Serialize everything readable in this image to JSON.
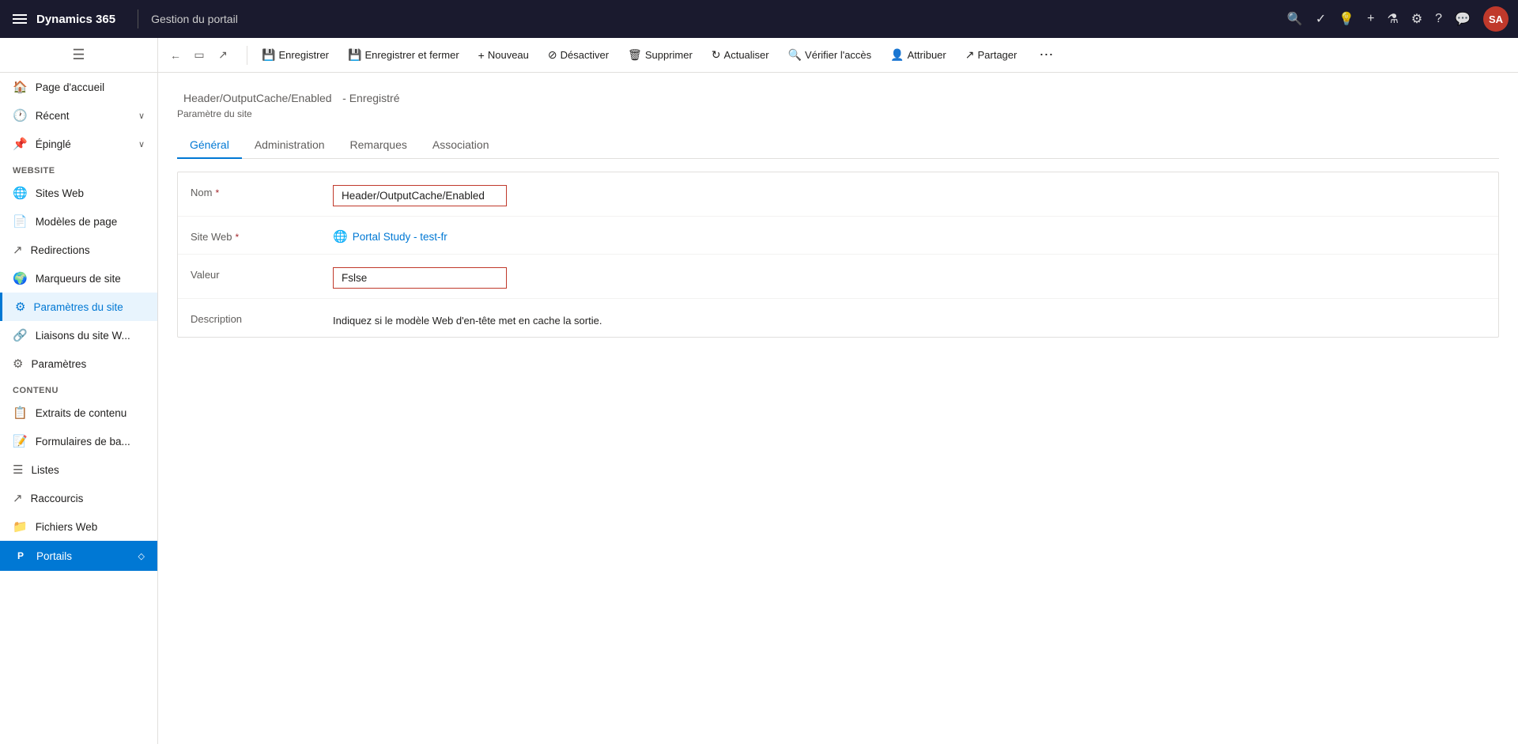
{
  "topbar": {
    "brand": "Dynamics 365",
    "portal": "Gestion du portail",
    "avatar": "SA",
    "icons": {
      "search": "🔍",
      "check": "✓",
      "bulb": "💡",
      "plus": "+",
      "filter": "⚗",
      "gear": "⚙",
      "help": "?",
      "chat": "💬"
    }
  },
  "cmdbar": {
    "back_icon": "←",
    "form_icon": "▭",
    "open_icon": "↗",
    "save_label": "Enregistrer",
    "save_close_label": "Enregistrer et fermer",
    "new_label": "Nouveau",
    "deactivate_label": "Désactiver",
    "delete_label": "Supprimer",
    "refresh_label": "Actualiser",
    "verify_label": "Vérifier l'accès",
    "assign_label": "Attribuer",
    "share_label": "Partager",
    "more": "⋯"
  },
  "sidebar": {
    "toggle_icon": "☰",
    "items": [
      {
        "id": "home",
        "label": "Page d'accueil",
        "icon": "🏠"
      },
      {
        "id": "recent",
        "label": "Récent",
        "icon": "🕐",
        "expand": "∨"
      },
      {
        "id": "pinned",
        "label": "Épinglé",
        "icon": "📌",
        "expand": "∨"
      }
    ],
    "website_section": "Website",
    "website_items": [
      {
        "id": "sites-web",
        "label": "Sites Web",
        "icon": "🌐"
      },
      {
        "id": "modeles",
        "label": "Modèles de page",
        "icon": "📄"
      },
      {
        "id": "redirections",
        "label": "Redirections",
        "icon": "↗"
      },
      {
        "id": "marqueurs",
        "label": "Marqueurs de site",
        "icon": "🌍"
      },
      {
        "id": "parametres-site",
        "label": "Paramètres du site",
        "icon": "⚙",
        "active": true
      },
      {
        "id": "liaisons",
        "label": "Liaisons du site W...",
        "icon": "🔗"
      },
      {
        "id": "parametres",
        "label": "Paramètres",
        "icon": "⚙"
      }
    ],
    "contenu_section": "Contenu",
    "contenu_items": [
      {
        "id": "extraits",
        "label": "Extraits de contenu",
        "icon": "📋"
      },
      {
        "id": "formulaires",
        "label": "Formulaires de ba...",
        "icon": "📝"
      },
      {
        "id": "listes",
        "label": "Listes",
        "icon": "☰"
      },
      {
        "id": "raccourcis",
        "label": "Raccourcis",
        "icon": "↗"
      },
      {
        "id": "fichiers",
        "label": "Fichiers Web",
        "icon": "📁"
      }
    ],
    "portals_item": {
      "id": "portals",
      "label": "Portails",
      "icon": "P",
      "expand": "◇"
    }
  },
  "page": {
    "title": "Header/OutputCache/Enabled",
    "status": "- Enregistré",
    "subtitle": "Paramètre du site",
    "tabs": [
      {
        "id": "general",
        "label": "Général",
        "active": true
      },
      {
        "id": "administration",
        "label": "Administration"
      },
      {
        "id": "remarques",
        "label": "Remarques"
      },
      {
        "id": "association",
        "label": "Association"
      }
    ]
  },
  "form": {
    "nom_label": "Nom",
    "nom_required": "*",
    "nom_value": "Header/OutputCache/Enabled",
    "site_web_label": "Site Web",
    "site_web_required": "*",
    "site_web_value": "Portal Study - test-fr",
    "valeur_label": "Valeur",
    "valeur_value": "Fslse",
    "description_label": "Description",
    "description_value": "Indiquez si le modèle Web d'en-tête met en cache la sortie."
  }
}
